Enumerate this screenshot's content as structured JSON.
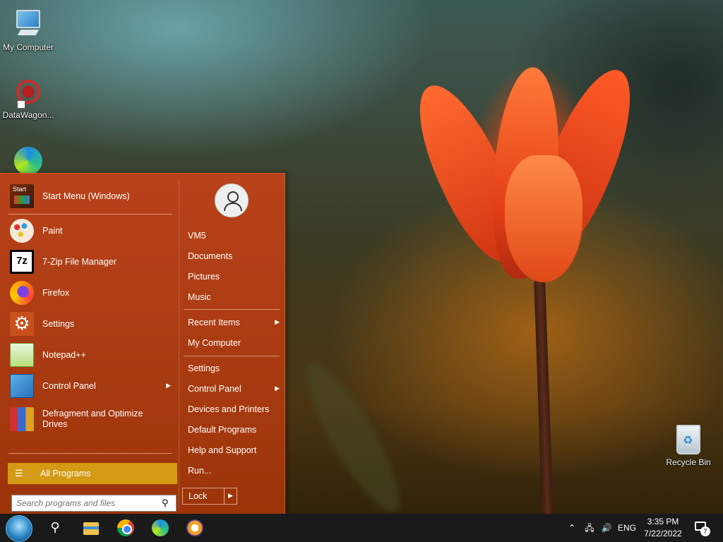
{
  "desktop": {
    "icons": [
      {
        "label": "My Computer",
        "icon": "computer-icon"
      },
      {
        "label": "DataWagon...",
        "icon": "datawagon-icon"
      },
      {
        "label": "",
        "icon": "edge-icon"
      },
      {
        "label": "Recycle Bin",
        "icon": "recycle-bin-icon"
      }
    ]
  },
  "start_menu": {
    "pinned": [
      {
        "label": "Start Menu (Windows)",
        "icon": "start-menu-app-icon",
        "icon_text": "Start"
      },
      {
        "label": "Paint",
        "icon": "paint-icon"
      },
      {
        "label": "7-Zip File Manager",
        "icon": "7zip-icon",
        "icon_text": "7z"
      },
      {
        "label": "Firefox",
        "icon": "firefox-icon"
      },
      {
        "label": "Settings",
        "icon": "settings-gear-icon"
      },
      {
        "label": "Notepad++",
        "icon": "notepadpp-icon"
      },
      {
        "label": "Control Panel",
        "icon": "control-panel-icon",
        "has_submenu": true
      },
      {
        "label": "Defragment and Optimize Drives",
        "icon": "defrag-icon"
      }
    ],
    "all_programs": "All Programs",
    "search": {
      "placeholder": "Search programs and files",
      "value": ""
    },
    "right": {
      "user": "VM5",
      "items": [
        {
          "label": "Documents"
        },
        {
          "label": "Pictures"
        },
        {
          "label": "Music"
        },
        {
          "label": "Recent Items",
          "has_submenu": true
        },
        {
          "label": "My Computer"
        },
        {
          "label": "Settings"
        },
        {
          "label": "Control Panel",
          "has_submenu": true
        },
        {
          "label": "Devices and Printers"
        },
        {
          "label": "Default Programs"
        },
        {
          "label": "Help and Support"
        },
        {
          "label": "Run..."
        }
      ],
      "lock": "Lock"
    },
    "colors": {
      "background": "#a83a10",
      "highlight": "#d49a14"
    }
  },
  "taskbar": {
    "apps": [
      "search-icon",
      "file-explorer-icon",
      "chrome-icon",
      "edge-icon",
      "security-shield-icon"
    ],
    "tray": {
      "language": "ENG",
      "time": "3:35 PM",
      "date": "7/22/2022",
      "notifications": "7"
    }
  }
}
